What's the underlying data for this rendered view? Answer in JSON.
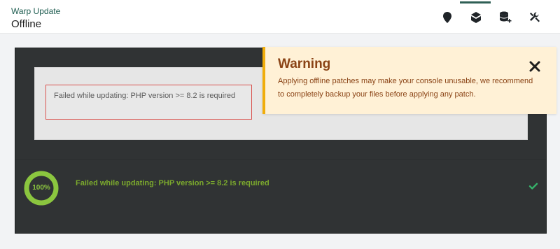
{
  "header": {
    "app_title": "Warp Update",
    "page_title": "Offline",
    "icons": [
      {
        "name": "location-pin-icon"
      },
      {
        "name": "box-icon"
      },
      {
        "name": "database-add-icon"
      },
      {
        "name": "tools-icon"
      }
    ]
  },
  "console": {
    "error_message": "Failed while updating: PHP version >= 8.2 is required",
    "status_message": "Failed while updating: PHP version >= 8.2 is required",
    "progress": {
      "value": 100,
      "label": "100%"
    }
  },
  "warning": {
    "title": "Warning",
    "message": "Applying offline patches may make your console unusable, we recommend to completely backup your files before applying any patch."
  },
  "colors": {
    "brand": "#1f5d51",
    "console_bg": "#303334",
    "warning_bg": "#fff1d6",
    "warning_border": "#f0ad0b",
    "success": "#8bc63f"
  }
}
